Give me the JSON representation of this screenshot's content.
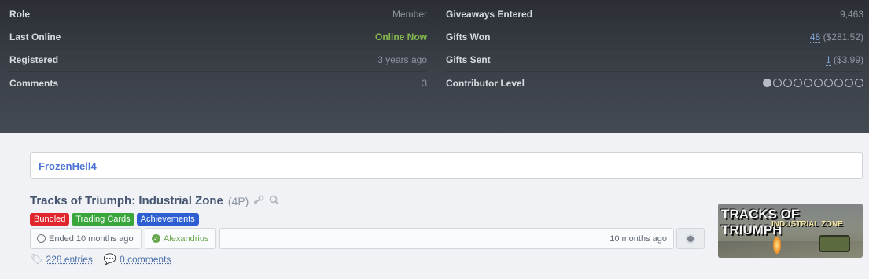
{
  "stats": {
    "left": [
      {
        "key": "Role",
        "value": "Member"
      },
      {
        "key": "Last Online",
        "value": "Online Now"
      },
      {
        "key": "Registered",
        "value": "3 years ago"
      },
      {
        "key": "Comments",
        "value": "3"
      }
    ],
    "right": [
      {
        "key": "Giveaways Entered",
        "value": "9,463"
      },
      {
        "key": "Gifts Won",
        "value": "48",
        "extra": "($281.52)"
      },
      {
        "key": "Gifts Sent",
        "value": "1",
        "extra": "($3.99)"
      },
      {
        "key": "Contributor Level",
        "filled_dots": 1,
        "total_dots": 10
      }
    ]
  },
  "user": {
    "name": "FrozenHell4"
  },
  "giveaway": {
    "title": "Tracks of Triumph: Industrial Zone",
    "copies": "(4P)",
    "badges": [
      "Bundled",
      "Trading Cards",
      "Achievements"
    ],
    "ended": "Ended 10 months ago",
    "winner": "Alexandrius",
    "time": "10 months ago",
    "entries": "228 entries",
    "comments": "0 comments",
    "thumbnail": {
      "line1": "TRACKS OF TRIUMPH",
      "line2": "INDUSTRIAL ZONE"
    }
  },
  "icons": {
    "steam": "steam-icon",
    "search": "search-icon",
    "clock": "clock-icon",
    "check": "check-icon",
    "globe": "globe-icon",
    "tag": "tag-icon",
    "comment": "comment-icon"
  },
  "colors": {
    "accent_link": "#4b72d4",
    "online": "#84b84d",
    "badge_bundled": "#e0262d",
    "badge_trading": "#39a63c",
    "badge_achievements": "#2d5fd2"
  }
}
